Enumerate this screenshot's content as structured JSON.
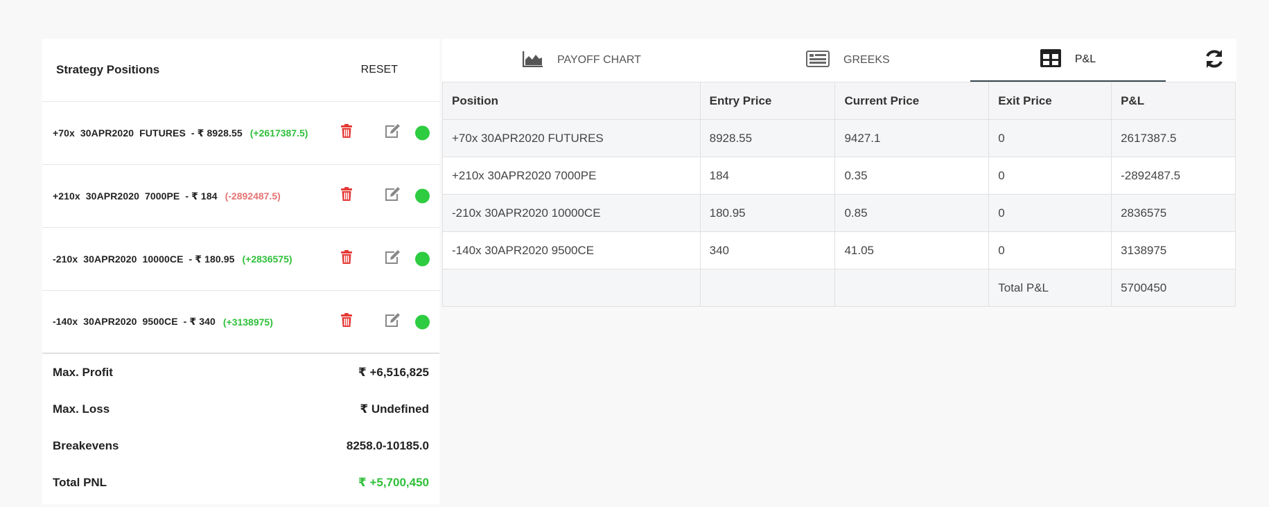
{
  "left": {
    "title": "Strategy Positions",
    "reset_label": "RESET",
    "positions": [
      {
        "text": "+70x  30APR2020  FUTURES  - ₹ 8928.55",
        "pnl": "(+2617387.5)"
      },
      {
        "text": "+210x  30APR2020  7000PE  - ₹ 184",
        "pnl": "(-2892487.5)"
      },
      {
        "text": "-210x  30APR2020  10000CE  - ₹ 180.95",
        "pnl": "(+2836575)"
      },
      {
        "text": "-140x  30APR2020  9500CE  - ₹ 340",
        "pnl": "(+3138975)"
      }
    ],
    "summary": [
      {
        "label": "Max. Profit",
        "value": "₹ +6,516,825"
      },
      {
        "label": "Max. Loss",
        "value": "₹ Undefined"
      },
      {
        "label": "Breakevens",
        "value": "8258.0-10185.0"
      },
      {
        "label": "Total PNL",
        "value": "₹ +5,700,450"
      }
    ]
  },
  "tabs": [
    {
      "label": "PAYOFF CHART",
      "icon": "area-chart-icon"
    },
    {
      "label": "GREEKS",
      "icon": "list-icon"
    },
    {
      "label": "P&L",
      "icon": "table-icon",
      "active": true
    }
  ],
  "table": {
    "headers": [
      "Position",
      "Entry Price",
      "Current Price",
      "Exit Price",
      "P&L"
    ],
    "rows": [
      [
        "+70x 30APR2020 FUTURES",
        "8928.55",
        "9427.1",
        "0",
        "2617387.5"
      ],
      [
        "+210x 30APR2020 7000PE",
        "184",
        "0.35",
        "0",
        "-2892487.5"
      ],
      [
        "-210x 30APR2020 10000CE",
        "180.95",
        "0.85",
        "0",
        "2836575"
      ],
      [
        "-140x 30APR2020 9500CE",
        "340",
        "41.05",
        "0",
        "3138975"
      ],
      [
        "",
        "",
        "",
        "Total P&L",
        "5700450"
      ]
    ]
  },
  "colors": {
    "profit": "#2fbf3a",
    "loss": "#e57373",
    "trash": "#e53935",
    "status": "#2ecc40"
  }
}
